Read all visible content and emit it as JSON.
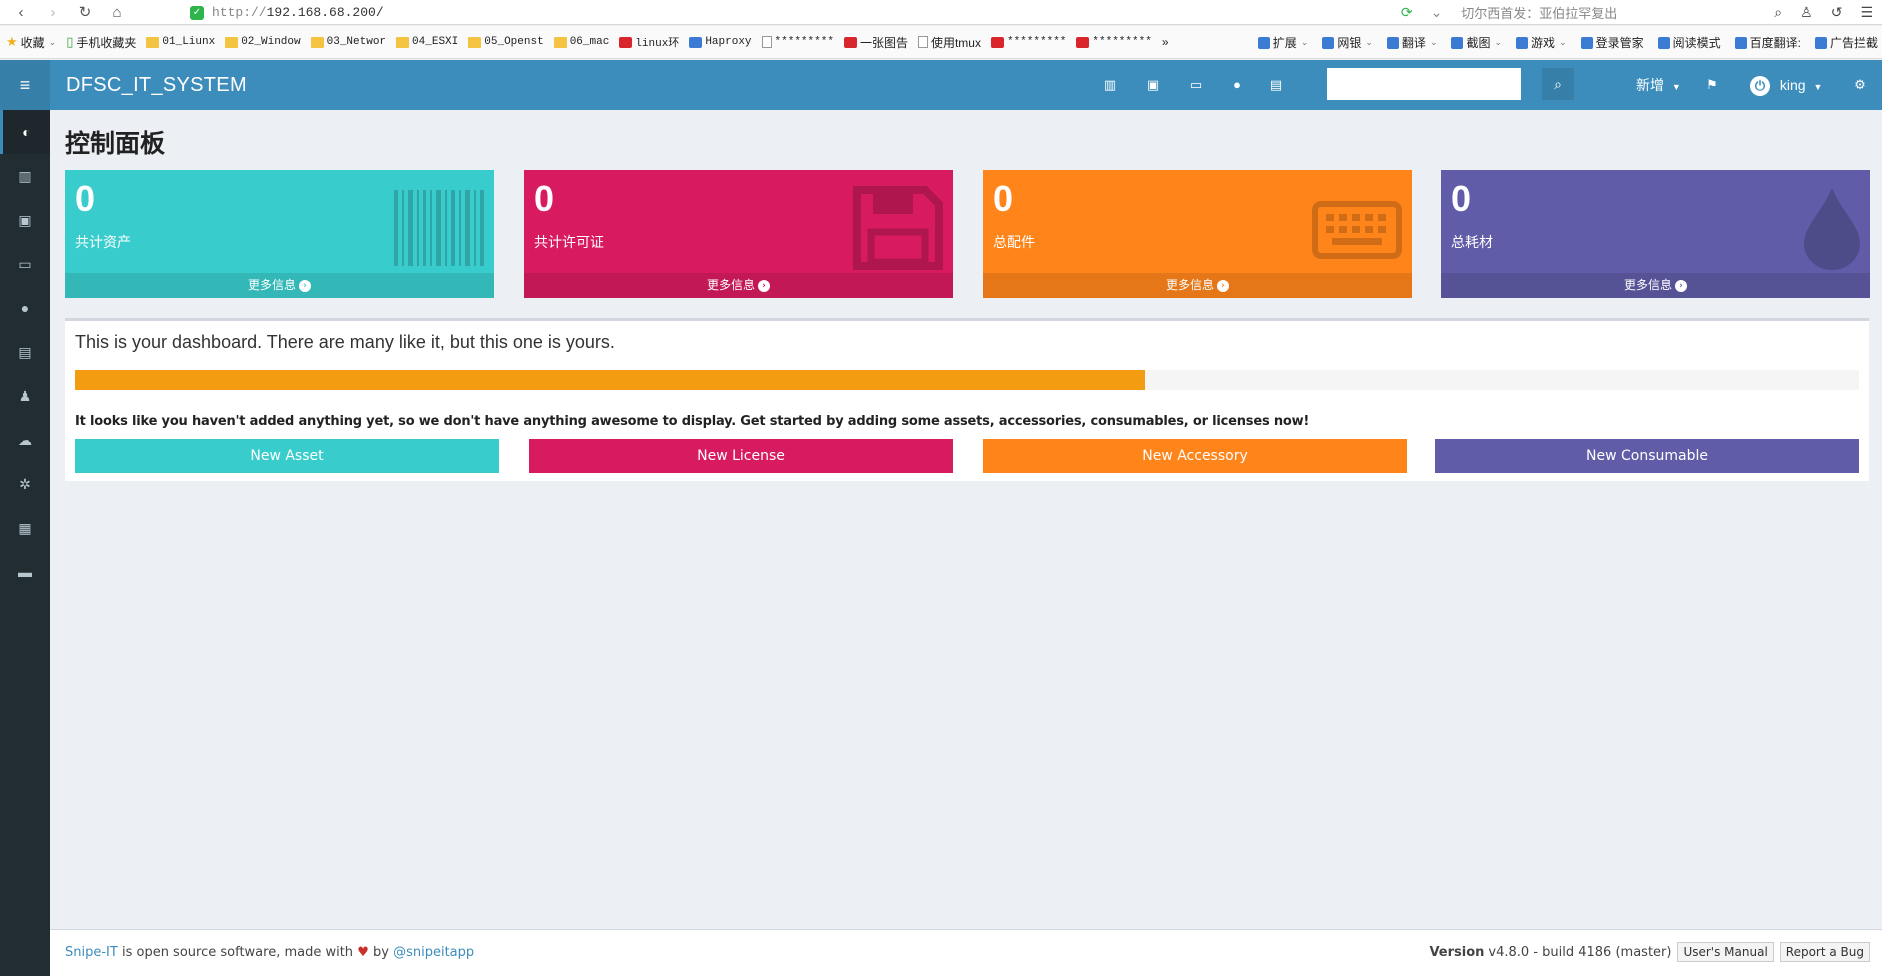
{
  "browser": {
    "url_protocol": "http://",
    "url_host": "192.168.68.200/",
    "news_ticker": "切尔西首发：亚伯拉罕复出",
    "bookmarks": [
      {
        "label": "收藏",
        "icon": "star",
        "caret": true
      },
      {
        "label": "手机收藏夹",
        "icon": "phone"
      },
      {
        "label": "01_Liunx",
        "icon": "folder",
        "mono": true
      },
      {
        "label": "02_Window",
        "icon": "folder",
        "mono": true
      },
      {
        "label": "03_Networ",
        "icon": "folder",
        "mono": true
      },
      {
        "label": "04_ESXI",
        "icon": "folder",
        "mono": true
      },
      {
        "label": "05_Openst",
        "icon": "folder",
        "mono": true
      },
      {
        "label": "06_mac",
        "icon": "folder",
        "mono": true
      },
      {
        "label": "linux环",
        "icon": "red",
        "mono": true
      },
      {
        "label": "Haproxy",
        "icon": "blue",
        "mono": true
      },
      {
        "label": "*********",
        "icon": "page",
        "mono": true
      },
      {
        "label": "一张图告",
        "icon": "red"
      },
      {
        "label": "使用tmux",
        "icon": "page"
      },
      {
        "label": "*********",
        "icon": "red",
        "mono": true
      },
      {
        "label": "*********",
        "icon": "red",
        "mono": true
      }
    ],
    "bookmarks_more": "»",
    "toolbar_right": [
      {
        "label": "扩展",
        "caret": true
      },
      {
        "label": "网银",
        "caret": true
      },
      {
        "label": "翻译",
        "caret": true
      },
      {
        "label": "截图",
        "caret": true
      },
      {
        "label": "游戏",
        "caret": true
      },
      {
        "label": "登录管家"
      },
      {
        "label": "阅读模式"
      },
      {
        "label": "百度翻译:"
      },
      {
        "label": "广告拦截"
      }
    ]
  },
  "app": {
    "brand": "DFSC_IT_SYSTEM",
    "new_menu": "新增",
    "user": "king",
    "search_value": "",
    "page_title": "控制面板"
  },
  "stat_boxes": [
    {
      "count": "0",
      "label": "共计资产",
      "footer": "更多信息",
      "color": "#39cccc",
      "icon": "barcode-icon"
    },
    {
      "count": "0",
      "label": "共计许可证",
      "footer": "更多信息",
      "color": "#d81b60",
      "icon": "save-icon"
    },
    {
      "count": "0",
      "label": "总配件",
      "footer": "更多信息",
      "color": "#ff851b",
      "icon": "keyboard-icon"
    },
    {
      "count": "0",
      "label": "总耗材",
      "footer": "更多信息",
      "color": "#605ca8",
      "icon": "tint-icon"
    }
  ],
  "dashboard": {
    "welcome": "This is your dashboard. There are many like it, but this one is yours.",
    "progress_percent": 60,
    "empty_message": "It looks like you haven't added anything yet, so we don't have anything awesome to display. Get started by adding some assets, accessories, consumables, or licenses now!",
    "buttons": [
      {
        "label": "New Asset",
        "color": "#39cccc"
      },
      {
        "label": "New License",
        "color": "#d81b60"
      },
      {
        "label": "New Accessory",
        "color": "#ff851b"
      },
      {
        "label": "New Consumable",
        "color": "#605ca8"
      }
    ]
  },
  "footer": {
    "app_link": "Snipe-IT",
    "text_1": "is open source software, made with",
    "text_2": "by",
    "twitter": "@snipeitapp",
    "version_label": "Version",
    "version": "v4.8.0 - build 4186 (master)",
    "manual": "User's Manual",
    "report": "Report a Bug"
  }
}
